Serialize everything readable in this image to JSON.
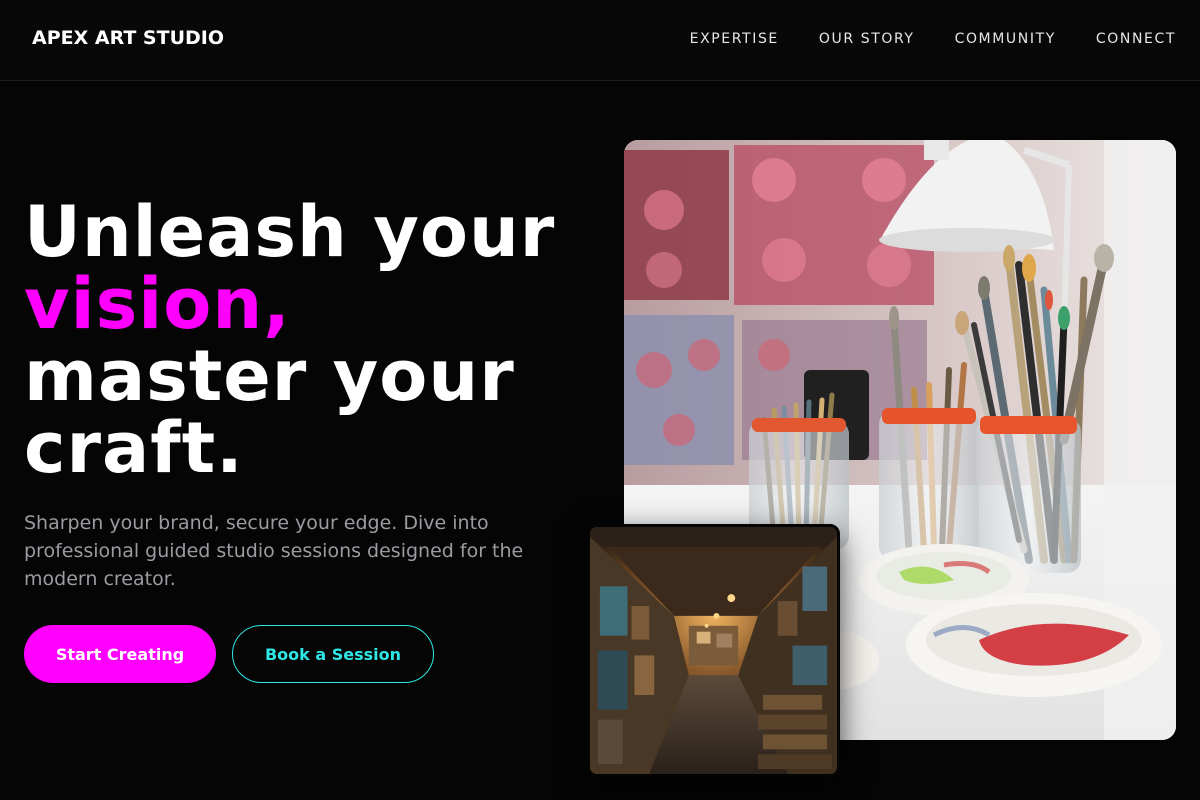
{
  "header": {
    "brand": "APEX ART STUDIO",
    "nav": [
      "EXPERTISE",
      "OUR STORY",
      "COMMUNITY",
      "CONNECT"
    ]
  },
  "hero": {
    "headline_line1": "Unleash your",
    "headline_accent": "vision,",
    "headline_line3": "master your",
    "headline_line4": "craft.",
    "subtext": "Sharpen your brand, secure your edge. Dive into professional guided studio sessions designed for the modern creator.",
    "primary_cta": "Start Creating",
    "secondary_cta": "Book a Session"
  },
  "images": {
    "main": "paintbrushes-in-jars-photo",
    "inset": "art-gallery-corridor-photo"
  },
  "colors": {
    "background": "#050505",
    "accent_magenta": "#ff00ff",
    "accent_cyan": "#2ee6e6",
    "muted_text": "#9b9ba2"
  }
}
